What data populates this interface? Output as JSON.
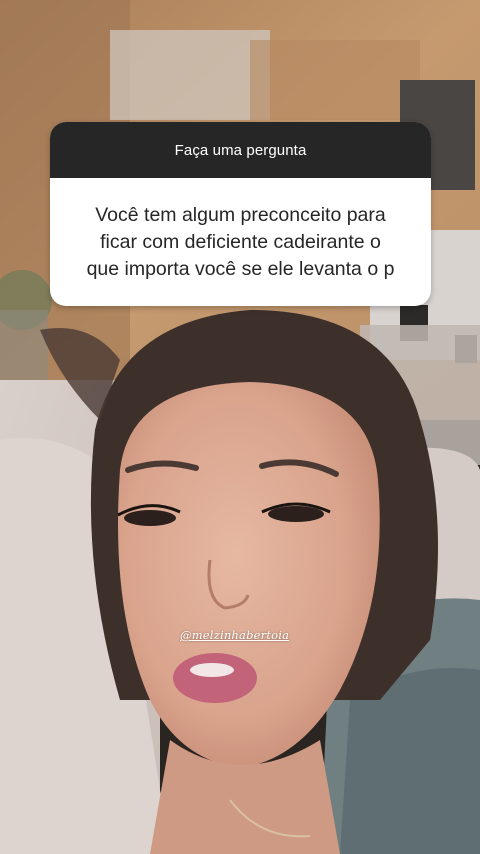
{
  "question_box": {
    "header": "Faça uma pergunta",
    "question": "Você tem algum preconceito para\nficar com deficiente cadeirante o\nque importa você se  ele levanta o p"
  },
  "mention": {
    "username": "@melzinhabertoia"
  },
  "colors": {
    "header_bg": "#262626",
    "card_bg": "#ffffff",
    "text": "#262626"
  }
}
